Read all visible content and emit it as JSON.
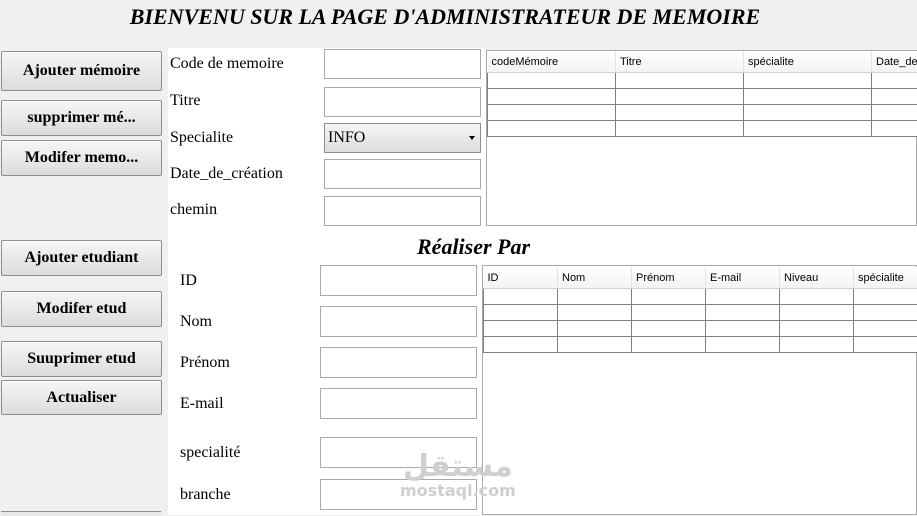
{
  "header": {
    "title": "BIENVENU SUR LA PAGE D'ADMINISTRATEUR DE MEMOIRE"
  },
  "sidebar": {
    "memoire_buttons": [
      "Ajouter mémoire",
      "supprimer mé...",
      "Modifer memo..."
    ],
    "etudiant_buttons": [
      "Ajouter etudiant",
      "Modifer etud",
      "Suuprimer etud",
      "Actualiser"
    ]
  },
  "memoire_form": {
    "labels": {
      "code": "Code de memoire",
      "titre": "Titre",
      "specialite": "Specialite",
      "date": "Date_de_création",
      "chemin": "chemin"
    },
    "specialite_selected": "INFO"
  },
  "memoire_table": {
    "columns": [
      "codeMémoire",
      "Titre",
      "spécialite",
      "Date_de"
    ]
  },
  "section": {
    "subtitle": "Réaliser Par"
  },
  "etudiant_form": {
    "labels": {
      "id": "ID",
      "nom": "Nom",
      "prenom": "Prénom",
      "email": "E-mail",
      "specialite": "specialité",
      "branche": "branche"
    }
  },
  "etudiant_table": {
    "columns": [
      "ID",
      "Nom",
      "Prénom",
      "E-mail",
      "Niveau",
      "spécialite"
    ]
  },
  "watermark": {
    "arabic": "مستقل",
    "latin": "mostaql.com"
  }
}
